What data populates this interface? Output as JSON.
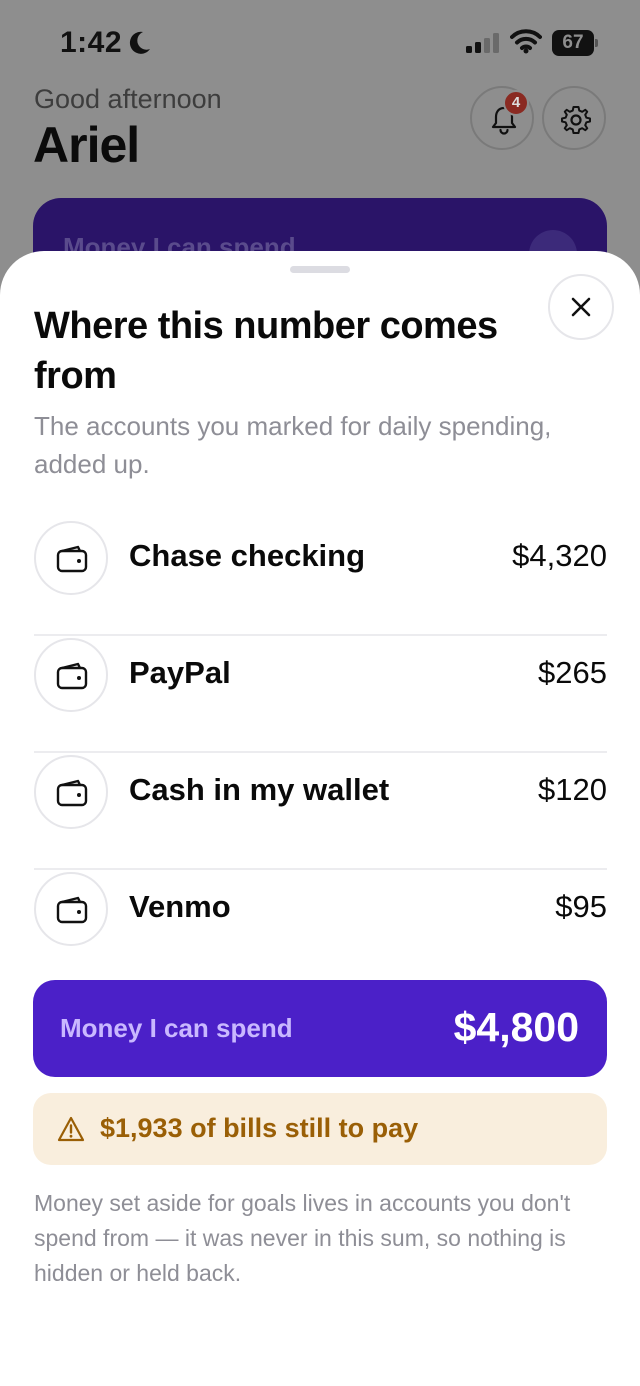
{
  "status_bar": {
    "time": "1:42",
    "battery": "67"
  },
  "background_screen": {
    "greeting": "Good afternoon",
    "user_name": "Ariel",
    "notification_count": "4",
    "card_label": "Money I can spend"
  },
  "sheet": {
    "title": "Where this number comes from",
    "subtitle": "The accounts you marked for daily spending, added up.",
    "accounts": [
      {
        "name": "Chase checking",
        "amount": "$4,320",
        "icon": "wallet-icon"
      },
      {
        "name": "PayPal",
        "amount": "$265",
        "icon": "wallet-icon"
      },
      {
        "name": "Cash in my wallet",
        "amount": "$120",
        "icon": "wallet-icon"
      },
      {
        "name": "Venmo",
        "amount": "$95",
        "icon": "wallet-icon"
      }
    ],
    "total": {
      "label": "Money I can spend",
      "amount": "$4,800"
    },
    "bills_banner": {
      "text": "$1,933 of bills still to pay",
      "icon": "warning-icon"
    },
    "footnote": "Money set aside for goals lives in accounts you don't spend from — it was never in this sum, so nothing is hidden or held back."
  },
  "colors": {
    "accent": "#4b20c8",
    "warning_bg": "#f9eedd",
    "warning_text": "#9a5f06"
  }
}
